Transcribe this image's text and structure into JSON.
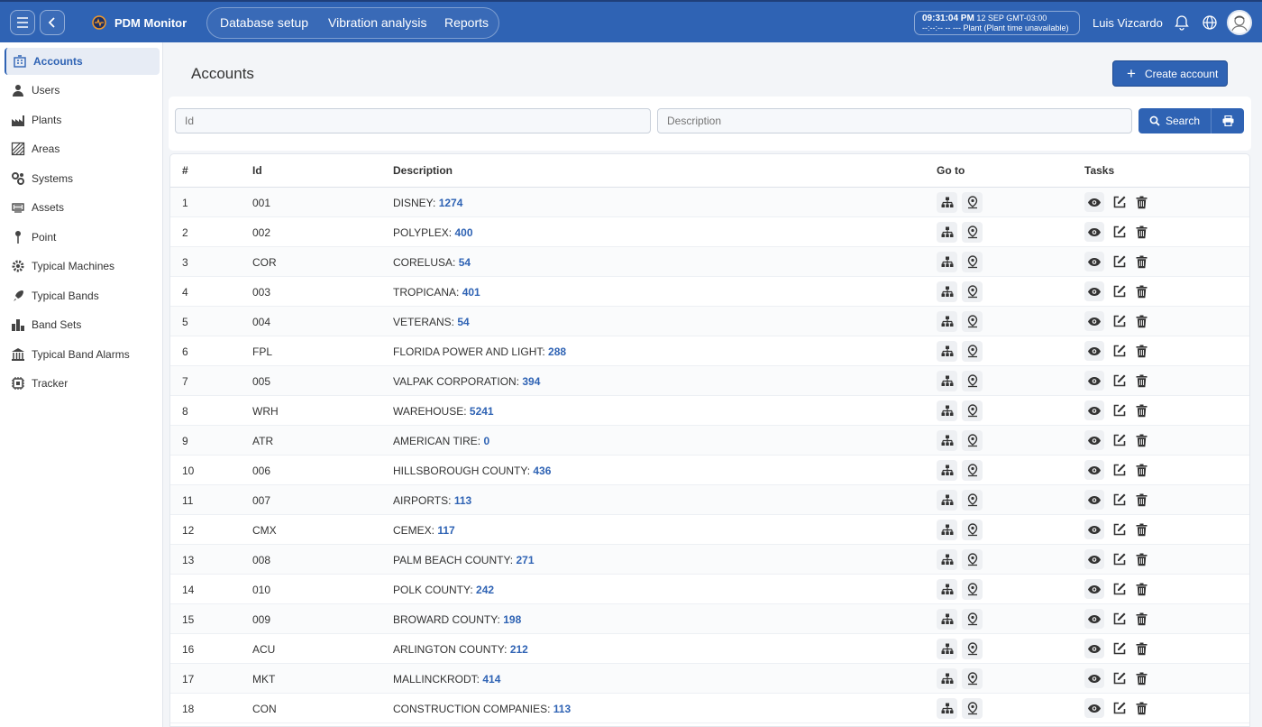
{
  "app": {
    "name": "PDM Monitor"
  },
  "nav": {
    "items": [
      "Database setup",
      "Vibration analysis",
      "Reports"
    ]
  },
  "clock": {
    "time": "09:31:04 PM",
    "date": "12 SEP",
    "tz": "GMT-03:00",
    "plant_line": "--:--:-- -- --- Plant (Plant time unavailable)"
  },
  "user": {
    "name": "Luis Vizcardo"
  },
  "sidebar": {
    "items": [
      {
        "label": "Accounts",
        "icon": "building-icon",
        "active": true
      },
      {
        "label": "Users",
        "icon": "user-icon"
      },
      {
        "label": "Plants",
        "icon": "factory-icon"
      },
      {
        "label": "Areas",
        "icon": "area-icon"
      },
      {
        "label": "Systems",
        "icon": "cogs-icon"
      },
      {
        "label": "Assets",
        "icon": "asset-icon"
      },
      {
        "label": "Point",
        "icon": "pin-icon"
      },
      {
        "label": "Typical Machines",
        "icon": "gear-icon"
      },
      {
        "label": "Typical Bands",
        "icon": "rocket-icon"
      },
      {
        "label": "Band Sets",
        "icon": "bars-icon"
      },
      {
        "label": "Typical Band Alarms",
        "icon": "bank-icon"
      },
      {
        "label": "Tracker",
        "icon": "chip-icon"
      }
    ]
  },
  "page": {
    "title": "Accounts",
    "create_label": "Create account"
  },
  "filters": {
    "id_placeholder": "Id",
    "description_placeholder": "Description",
    "search_label": "Search"
  },
  "table": {
    "headers": {
      "num": "#",
      "id": "Id",
      "description": "Description",
      "goto": "Go to",
      "tasks": "Tasks"
    },
    "rows": [
      {
        "num": "1",
        "id": "001",
        "name": "DISNEY:",
        "count": "1274"
      },
      {
        "num": "2",
        "id": "002",
        "name": "POLYPLEX:",
        "count": "400"
      },
      {
        "num": "3",
        "id": "COR",
        "name": "CORELUSA:",
        "count": "54"
      },
      {
        "num": "4",
        "id": "003",
        "name": "TROPICANA:",
        "count": "401"
      },
      {
        "num": "5",
        "id": "004",
        "name": "VETERANS:",
        "count": "54"
      },
      {
        "num": "6",
        "id": "FPL",
        "name": "FLORIDA POWER AND LIGHT:",
        "count": "288"
      },
      {
        "num": "7",
        "id": "005",
        "name": "VALPAK CORPORATION:",
        "count": "394"
      },
      {
        "num": "8",
        "id": "WRH",
        "name": "WAREHOUSE:",
        "count": "5241"
      },
      {
        "num": "9",
        "id": "ATR",
        "name": "AMERICAN TIRE:",
        "count": "0"
      },
      {
        "num": "10",
        "id": "006",
        "name": "HILLSBOROUGH COUNTY:",
        "count": "436"
      },
      {
        "num": "11",
        "id": "007",
        "name": "AIRPORTS:",
        "count": "113"
      },
      {
        "num": "12",
        "id": "CMX",
        "name": "CEMEX:",
        "count": "117"
      },
      {
        "num": "13",
        "id": "008",
        "name": "PALM BEACH COUNTY:",
        "count": "271"
      },
      {
        "num": "14",
        "id": "010",
        "name": "POLK COUNTY:",
        "count": "242"
      },
      {
        "num": "15",
        "id": "009",
        "name": "BROWARD COUNTY:",
        "count": "198"
      },
      {
        "num": "16",
        "id": "ACU",
        "name": "ARLINGTON COUNTY:",
        "count": "212"
      },
      {
        "num": "17",
        "id": "MKT",
        "name": "MALLINCKRODT:",
        "count": "414"
      },
      {
        "num": "18",
        "id": "CON",
        "name": "CONSTRUCTION COMPANIES:",
        "count": "113"
      }
    ]
  }
}
